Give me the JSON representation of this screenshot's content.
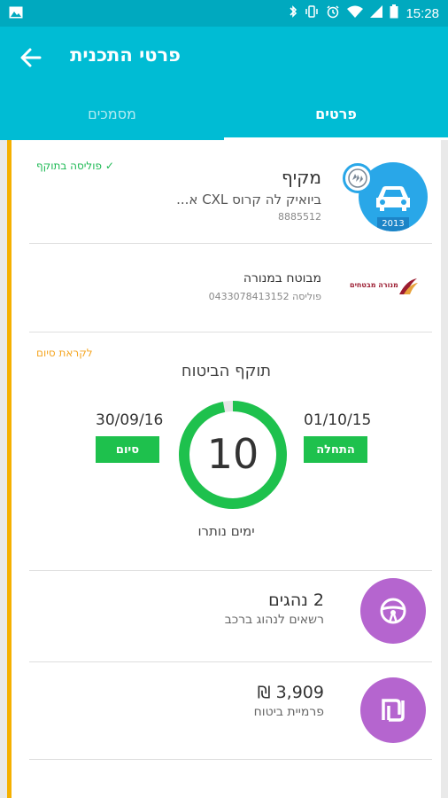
{
  "status_bar": {
    "time": "15:28",
    "icons": [
      "image-icon",
      "bluetooth-icon",
      "vibrate-icon",
      "alarm-icon",
      "wifi-icon",
      "signal-icon",
      "battery-icon"
    ]
  },
  "app_bar": {
    "title": "פרטי התכנית",
    "back_icon": "arrow-left-icon"
  },
  "tabs": [
    {
      "label": "פרטים",
      "active": true
    },
    {
      "label": "מסמכים",
      "active": false
    }
  ],
  "vehicle": {
    "type": "מקיף",
    "model": "ביואיק לה קרוס CXL א...",
    "number": "8885512",
    "year": "2013",
    "policy_status": "פוליסה בתוקף",
    "icon": "car-icon",
    "brand_icon": "buick-logo-icon"
  },
  "insurer": {
    "name": "מבוטח במנורה",
    "policy": "פוליסה 0433078413152",
    "logo_text": "מנורה מבטחים"
  },
  "validity": {
    "ending_soon": "לקראת סיום",
    "title": "תוקף הביטוח",
    "start_date": "01/10/15",
    "end_date": "30/09/16",
    "start_label": "התחלה",
    "end_label": "סיום",
    "days_remaining": "10",
    "days_label": "ימים נותרו",
    "remaining_fraction": 0.97,
    "ring_color": "#1ec14d"
  },
  "drivers": {
    "title": "2 נהגים",
    "subtitle": "רשאים לנהוג ברכב",
    "icon": "steering-wheel-icon"
  },
  "premium": {
    "amount": "₪ 3,909",
    "label": "פרמיית ביטוח",
    "icon": "shekel-icon"
  },
  "colors": {
    "primary": "#00bcd4",
    "status_bar": "#00a9bf",
    "accent_green": "#1ec14d",
    "warning_orange": "#f5a623",
    "purple": "#b565cf",
    "car_blue": "#29a7e8"
  }
}
